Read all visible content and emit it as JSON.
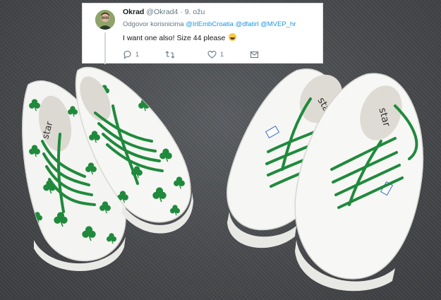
{
  "tweet": {
    "display_name": "Okrad",
    "handle": "@Okrad4",
    "separator": " · ",
    "date": "9. ožu",
    "reply_prefix": "Odgovor korisnicima",
    "mentions": [
      "@IrlEmbCroatia",
      "@dfatirl",
      "@MVEP_hr"
    ],
    "text": "I want one also! Size 44 please",
    "emoji": "grinning-sweat-face",
    "reply_count": "1",
    "like_count": "1"
  },
  "photo": {
    "shoe_brand_left": "star",
    "shoe_brand_right": "star",
    "lace_color": "#1f8a3c",
    "clover_color": "#1f8a3c"
  },
  "icons": {
    "reply": "reply-icon",
    "retweet": "retweet-icon",
    "like": "heart-icon",
    "message": "envelope-icon"
  }
}
